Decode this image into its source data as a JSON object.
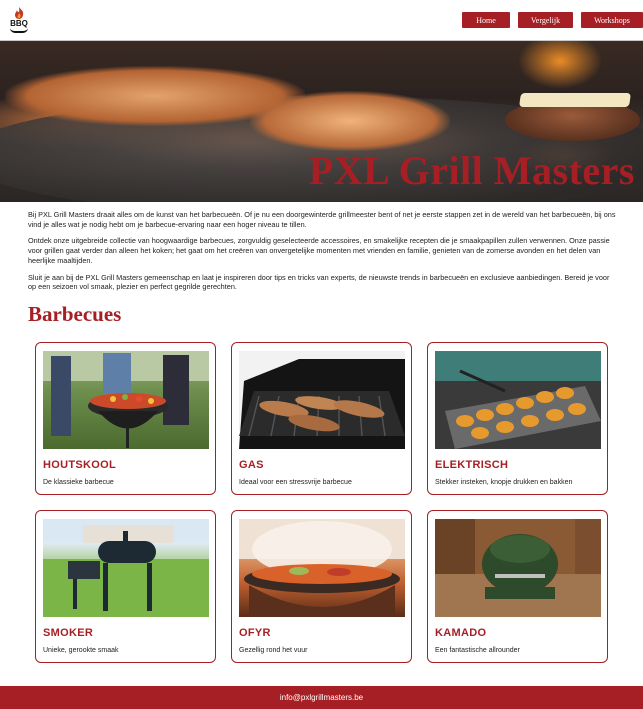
{
  "header": {
    "logo_text": "BBQ",
    "nav": [
      "Home",
      "Vergelijk",
      "Workshops"
    ]
  },
  "hero": {
    "title": "PXL Grill Masters"
  },
  "intro": {
    "p1": "Bij PXL Grill Masters draait alles om de kunst van het barbecueën. Of je nu een doorgewinterde grillmeester bent of net je eerste stappen zet in de wereld van het barbecueën, bij ons vind je alles wat je nodig hebt om je barbecue-ervaring naar een hoger niveau te tillen.",
    "p2": "Ontdek onze uitgebreide collectie van hoogwaardige barbecues, zorgvuldig geselecteerde accessoires, en smakelijke recepten die je smaakpapillen zullen verwennen. Onze passie voor grillen gaat verder dan alleen het koken; het gaat om het creëren van onvergetelijke momenten met vrienden en familie, genieten van de zomerse avonden en het delen van heerlijke maaltijden.",
    "p3": "Sluit je aan bij de PXL Grill Masters gemeenschap en laat je inspireren door tips en tricks van experts, de nieuwste trends in barbecueën en exclusieve aanbiedingen. Bereid je voor op een seizoen vol smaak, plezier en perfect gegrilde gerechten."
  },
  "section": {
    "title": "Barbecues"
  },
  "cards": [
    {
      "title": "HOUTSKOOL",
      "desc": "De klassieke barbecue"
    },
    {
      "title": "GAS",
      "desc": "Ideaal voor een stressvrije barbecue"
    },
    {
      "title": "ELEKTRISCH",
      "desc": "Stekker insteken, knopje drukken en bakken"
    },
    {
      "title": "SMOKER",
      "desc": "Unieke, gerookte smaak"
    },
    {
      "title": "OFYR",
      "desc": "Gezellig rond het vuur"
    },
    {
      "title": "KAMADO",
      "desc": "Een fantastische allrounder"
    }
  ],
  "footer": {
    "email": "info@pxlgrillmasters.be"
  },
  "colors": {
    "accent": "#a51f24",
    "background": "#ffffff"
  }
}
